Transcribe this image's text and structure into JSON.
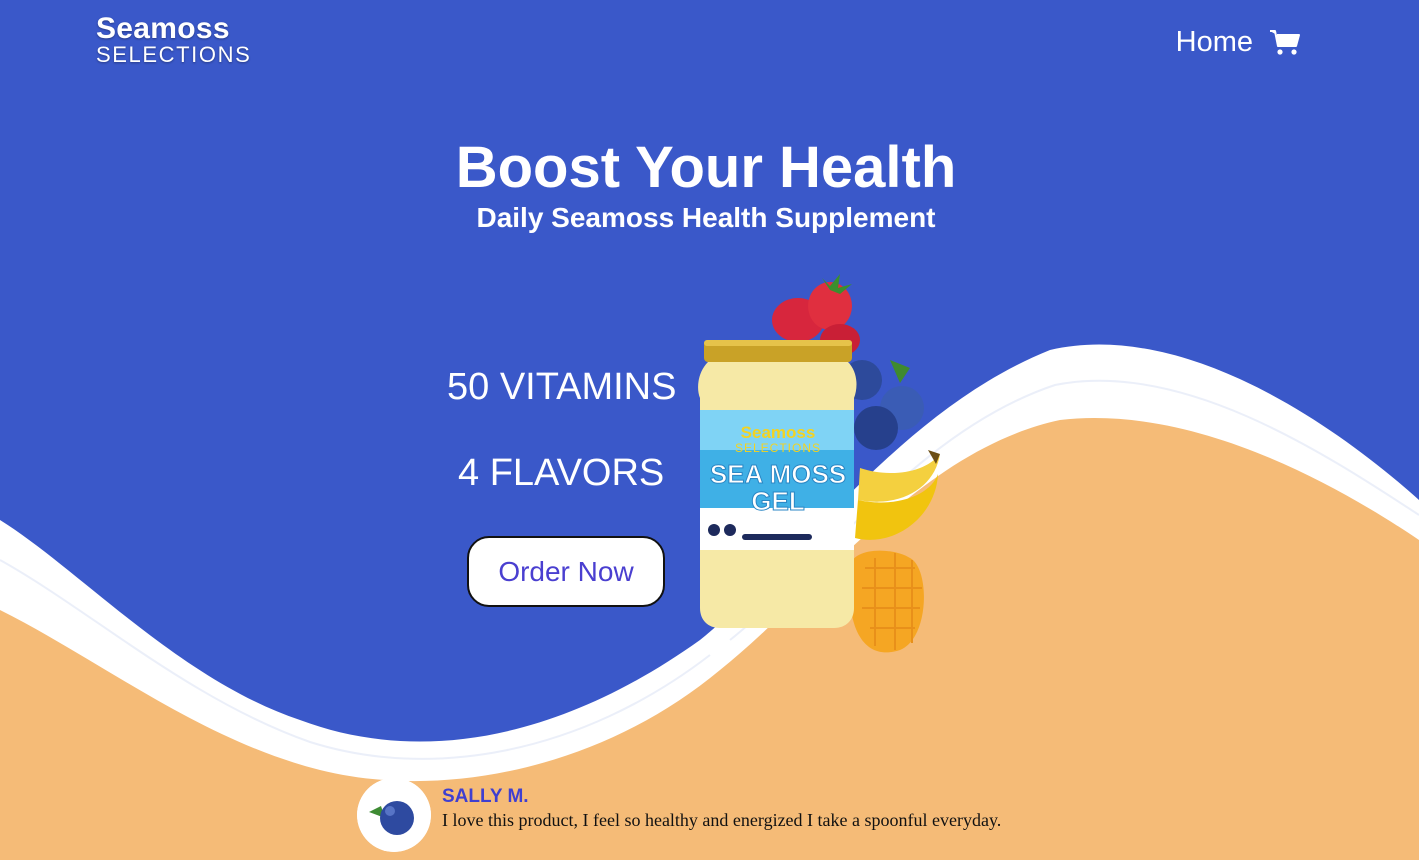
{
  "brand": {
    "name_top": "Seamoss",
    "name_bottom": "SELECTIONS"
  },
  "nav": {
    "home": "Home",
    "cart_icon": "shopping-cart-icon"
  },
  "hero": {
    "title": "Boost Your Health",
    "subtitle": "Daily Seamoss Health Supplement",
    "stat1": "50 VITAMINS",
    "stat2": "4 FLAVORS",
    "cta": "Order Now"
  },
  "product": {
    "label_brand_top": "Seamoss",
    "label_brand_bottom": "SELECTIONS",
    "label_title_1": "SEA MOSS",
    "label_title_2": "GEL"
  },
  "testimonial": {
    "name": "SALLY M.",
    "text": "I love this product, I feel so healthy and energized I take a spoonful everyday."
  },
  "colors": {
    "primary_blue": "#3a58c9",
    "sand": "#f5bb77",
    "accent_text": "#3f3fd0"
  }
}
